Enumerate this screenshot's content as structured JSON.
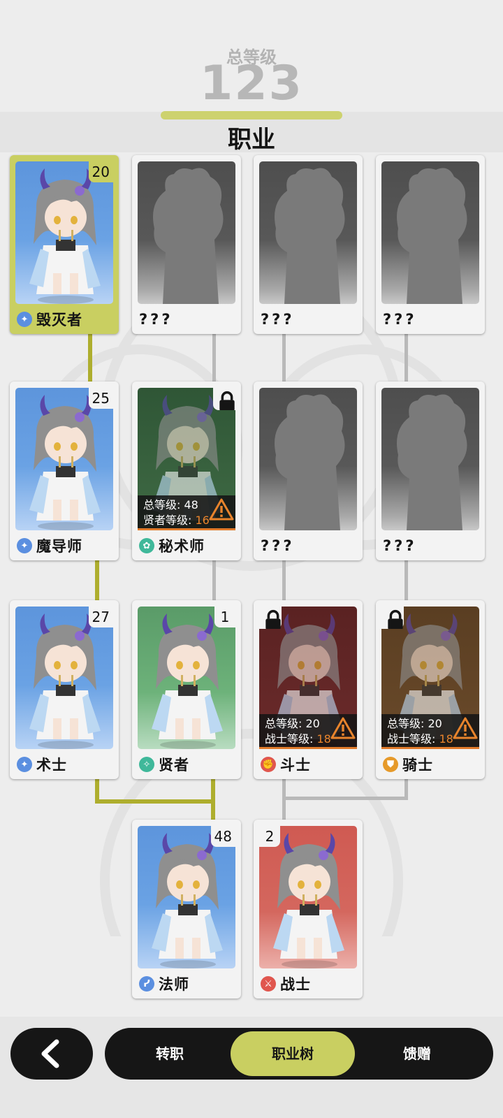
{
  "header": {
    "total_level_label": "总等级",
    "total_level_value": "123",
    "title": "职业"
  },
  "cards": {
    "destroyer": {
      "level": "20",
      "name": "毁灭者",
      "icon_color": "#5b8fe0"
    },
    "unknown_1": {
      "name": "???"
    },
    "unknown_2": {
      "name": "???"
    },
    "unknown_3": {
      "name": "???"
    },
    "archmage": {
      "level": "25",
      "name": "魔导师",
      "icon_color": "#5b8fe0"
    },
    "arcanist": {
      "name": "秘术师",
      "icon_color": "#3fb89a",
      "locked": true,
      "req_total_label": "总等级:",
      "req_total_value": "48",
      "req_class_label": "贤者等级:",
      "req_class_value": "16"
    },
    "unknown_4": {
      "name": "???"
    },
    "unknown_5": {
      "name": "???"
    },
    "warlock": {
      "level": "27",
      "name": "术士",
      "icon_color": "#5b8fe0"
    },
    "sage": {
      "level": "1",
      "name": "贤者",
      "icon_color": "#3fb89a"
    },
    "fighter": {
      "name": "斗士",
      "icon_color": "#e0564e",
      "locked": true,
      "req_total_label": "总等级:",
      "req_total_value": "20",
      "req_class_label": "战士等级:",
      "req_class_value": "18"
    },
    "knight": {
      "name": "骑士",
      "icon_color": "#e69a2a",
      "locked": true,
      "req_total_label": "总等级:",
      "req_total_value": "20",
      "req_class_label": "战士等级:",
      "req_class_value": "18"
    },
    "mage": {
      "level": "48",
      "name": "法师",
      "icon_color": "#5b8fe0"
    },
    "warrior": {
      "level": "2",
      "name": "战士",
      "icon_color": "#e0564e"
    }
  },
  "nav": {
    "back_icon": "chevron-left-icon",
    "tabs": [
      {
        "label": "转职"
      },
      {
        "label": "职业树",
        "active": true
      },
      {
        "label": "馈赠"
      }
    ]
  },
  "colors": {
    "accent": "#c9cf61",
    "path_active": "#aeae2e",
    "warning": "#e8842c"
  }
}
